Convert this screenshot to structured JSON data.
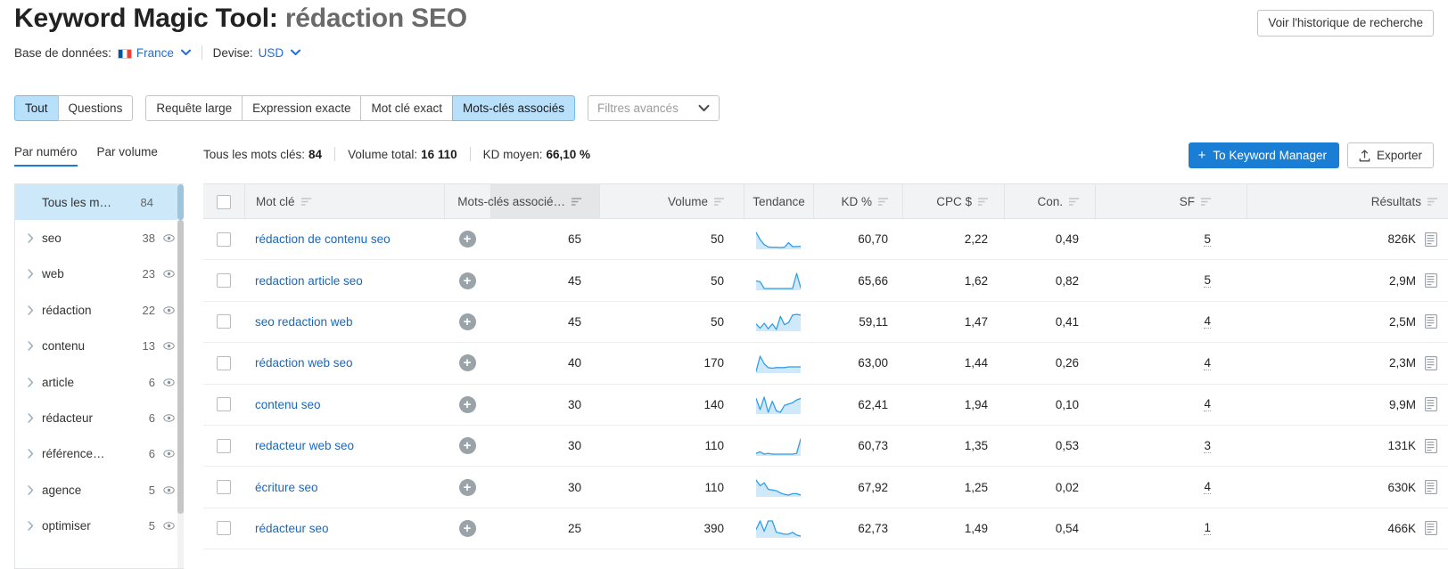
{
  "header": {
    "title_main": "Keyword Magic Tool:",
    "title_query": "rédaction SEO",
    "database_label": "Base de données:",
    "database_value": "France",
    "currency_label": "Devise:",
    "currency_value": "USD",
    "history_button": "Voir l'historique de recherche"
  },
  "filters": {
    "match_tabs": [
      "Tout",
      "Questions"
    ],
    "type_tabs": [
      "Requête large",
      "Expression exacte",
      "Mot clé exact",
      "Mots-clés associés"
    ],
    "active_match_tab": "Tout",
    "active_type_tab": "Mots-clés associés",
    "advanced_filters_placeholder": "Filtres avancés"
  },
  "summary": {
    "subtabs": [
      "Par numéro",
      "Par volume"
    ],
    "active_subtab": "Par numéro",
    "total_keywords_label": "Tous les mots clés:",
    "total_keywords_value": "84",
    "total_volume_label": "Volume total:",
    "total_volume_value": "16 110",
    "avg_kd_label": "KD moyen:",
    "avg_kd_value": "66,10 %",
    "keyword_manager_button": "To Keyword Manager",
    "export_button": "Exporter"
  },
  "sidebar": {
    "header": {
      "label": "Tous les m…",
      "count": "84"
    },
    "items": [
      {
        "label": "seo",
        "count": "38"
      },
      {
        "label": "web",
        "count": "23"
      },
      {
        "label": "rédaction",
        "count": "22"
      },
      {
        "label": "contenu",
        "count": "13"
      },
      {
        "label": "article",
        "count": "6"
      },
      {
        "label": "rédacteur",
        "count": "6"
      },
      {
        "label": "référence…",
        "count": "6"
      },
      {
        "label": "agence",
        "count": "5"
      },
      {
        "label": "optimiser",
        "count": "5"
      }
    ]
  },
  "table": {
    "columns": [
      {
        "key": "checkbox",
        "label": ""
      },
      {
        "key": "keyword",
        "label": "Mot clé",
        "sortable": true
      },
      {
        "key": "add",
        "label": ""
      },
      {
        "key": "assoc",
        "label": "Mots-clés associé…",
        "sortable": true,
        "sorted": true
      },
      {
        "key": "volume",
        "label": "Volume",
        "sortable": true
      },
      {
        "key": "trend",
        "label": "Tendance",
        "sortable": false
      },
      {
        "key": "kd",
        "label": "KD %",
        "sortable": true
      },
      {
        "key": "cpc",
        "label": "CPC $",
        "sortable": true
      },
      {
        "key": "con",
        "label": "Con.",
        "sortable": true
      },
      {
        "key": "sf",
        "label": "SF",
        "sortable": true
      },
      {
        "key": "results",
        "label": "Résultats",
        "sortable": true
      }
    ],
    "rows": [
      {
        "keyword": "rédaction de contenu seo",
        "assoc": "65",
        "volume": "50",
        "kd": "60,70",
        "cpc": "2,22",
        "con": "0,49",
        "sf": "5",
        "results": "826K",
        "trend": [
          62,
          40,
          24,
          17,
          16,
          16,
          15,
          16,
          30,
          18,
          18,
          19
        ]
      },
      {
        "keyword": "redaction article seo",
        "assoc": "45",
        "volume": "50",
        "kd": "65,66",
        "cpc": "1,62",
        "con": "0,82",
        "sf": "5",
        "results": "2,9M",
        "trend": [
          40,
          38,
          22,
          22,
          22,
          22,
          22,
          22,
          22,
          22,
          58,
          24
        ]
      },
      {
        "keyword": "seo redaction web",
        "assoc": "45",
        "volume": "50",
        "kd": "59,11",
        "cpc": "1,47",
        "con": "0,41",
        "sf": "4",
        "results": "2,5M",
        "trend": [
          30,
          18,
          32,
          16,
          30,
          14,
          52,
          28,
          34,
          56,
          58,
          56
        ]
      },
      {
        "keyword": "rédaction web seo",
        "assoc": "40",
        "volume": "170",
        "kd": "63,00",
        "cpc": "1,44",
        "con": "0,26",
        "sf": "4",
        "results": "2,3M",
        "trend": [
          12,
          60,
          36,
          24,
          22,
          24,
          24,
          24,
          26,
          26,
          26,
          26
        ]
      },
      {
        "keyword": "contenu seo",
        "assoc": "30",
        "volume": "140",
        "kd": "62,41",
        "cpc": "1,94",
        "con": "0,10",
        "sf": "4",
        "results": "9,9M",
        "trend": [
          50,
          34,
          52,
          30,
          46,
          32,
          30,
          40,
          42,
          44,
          48,
          50
        ]
      },
      {
        "keyword": "redacteur web seo",
        "assoc": "30",
        "volume": "110",
        "kd": "60,73",
        "cpc": "1,35",
        "con": "0,53",
        "sf": "3",
        "results": "131K",
        "trend": [
          22,
          26,
          20,
          22,
          20,
          20,
          20,
          20,
          20,
          20,
          22,
          60
        ]
      },
      {
        "keyword": "écriture seo",
        "assoc": "30",
        "volume": "110",
        "kd": "67,92",
        "cpc": "1,25",
        "con": "0,02",
        "sf": "4",
        "results": "630K",
        "trend": [
          60,
          44,
          52,
          34,
          32,
          30,
          24,
          20,
          18,
          22,
          22,
          18
        ]
      },
      {
        "keyword": "rédacteur seo",
        "assoc": "25",
        "volume": "390",
        "kd": "62,73",
        "cpc": "1,49",
        "con": "0,54",
        "sf": "1",
        "results": "466K",
        "trend": [
          36,
          54,
          32,
          54,
          54,
          30,
          28,
          26,
          26,
          30,
          24,
          22
        ]
      }
    ]
  },
  "icons": {
    "chevron_down": "chevron-down-icon",
    "sort": "sort-icon",
    "eye": "eye-icon",
    "plus": "+",
    "serp": "serp-icon",
    "upload": "upload-icon"
  },
  "colors": {
    "accent_blue": "#1a7fd4",
    "link_blue": "#1868bf",
    "active_tab_bg": "#b8e0fb",
    "sidebar_active_bg": "#cde8f9",
    "spark_line": "#2f9fe8",
    "spark_fill": "#cfe8fa"
  }
}
